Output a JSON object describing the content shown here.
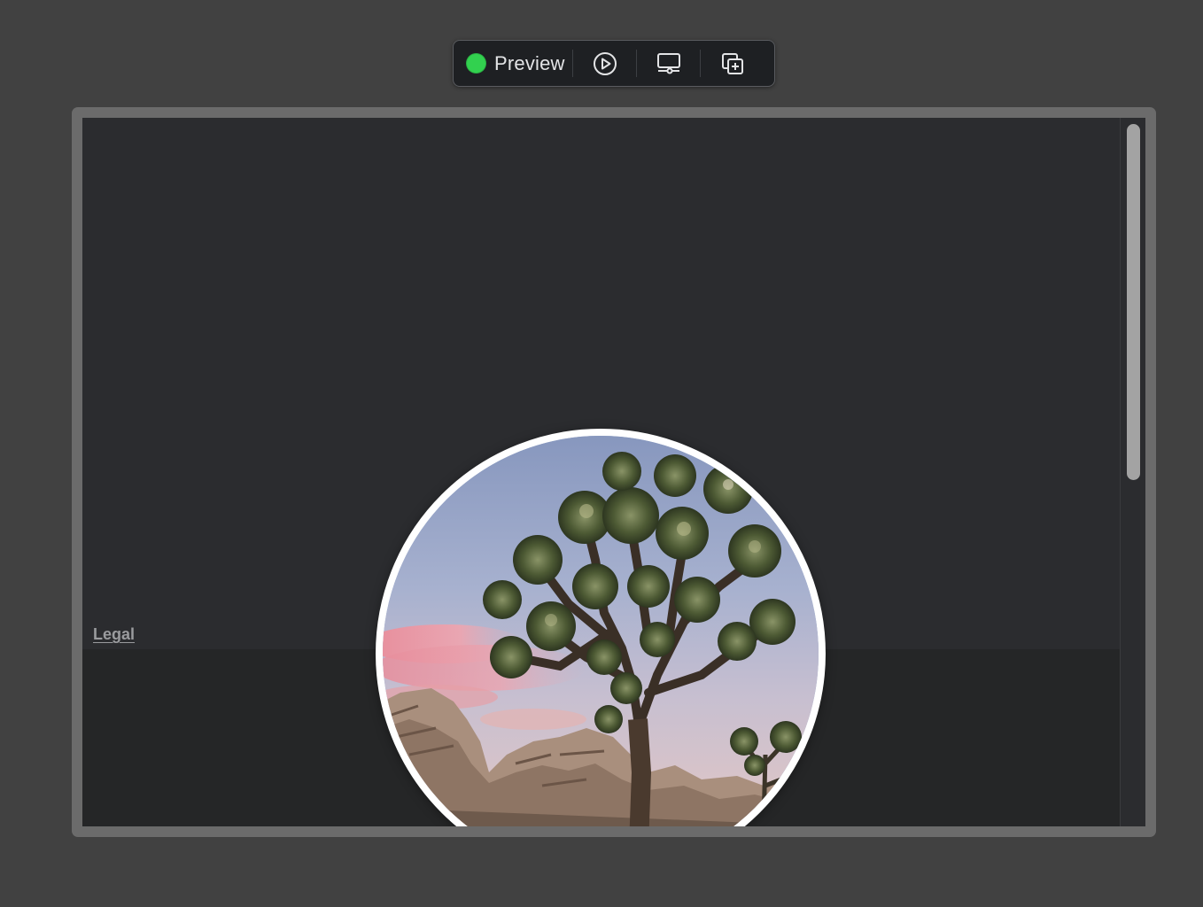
{
  "toolbar": {
    "status_label": "Preview",
    "status_color": "#32d14f",
    "buttons": [
      {
        "icon": "play-circle-icon"
      },
      {
        "icon": "display-icon"
      },
      {
        "icon": "duplicate-icon"
      }
    ]
  },
  "page": {
    "legal_link": "Legal"
  },
  "avatar": {
    "subject": "joshua-tree-photo"
  },
  "colors": {
    "desktop_bg": "#414141",
    "frame": "#6b6b6b",
    "viewport_bg": "#2b2c2f",
    "footer_bg": "#252627",
    "scroll_thumb": "#a3a3a3"
  }
}
